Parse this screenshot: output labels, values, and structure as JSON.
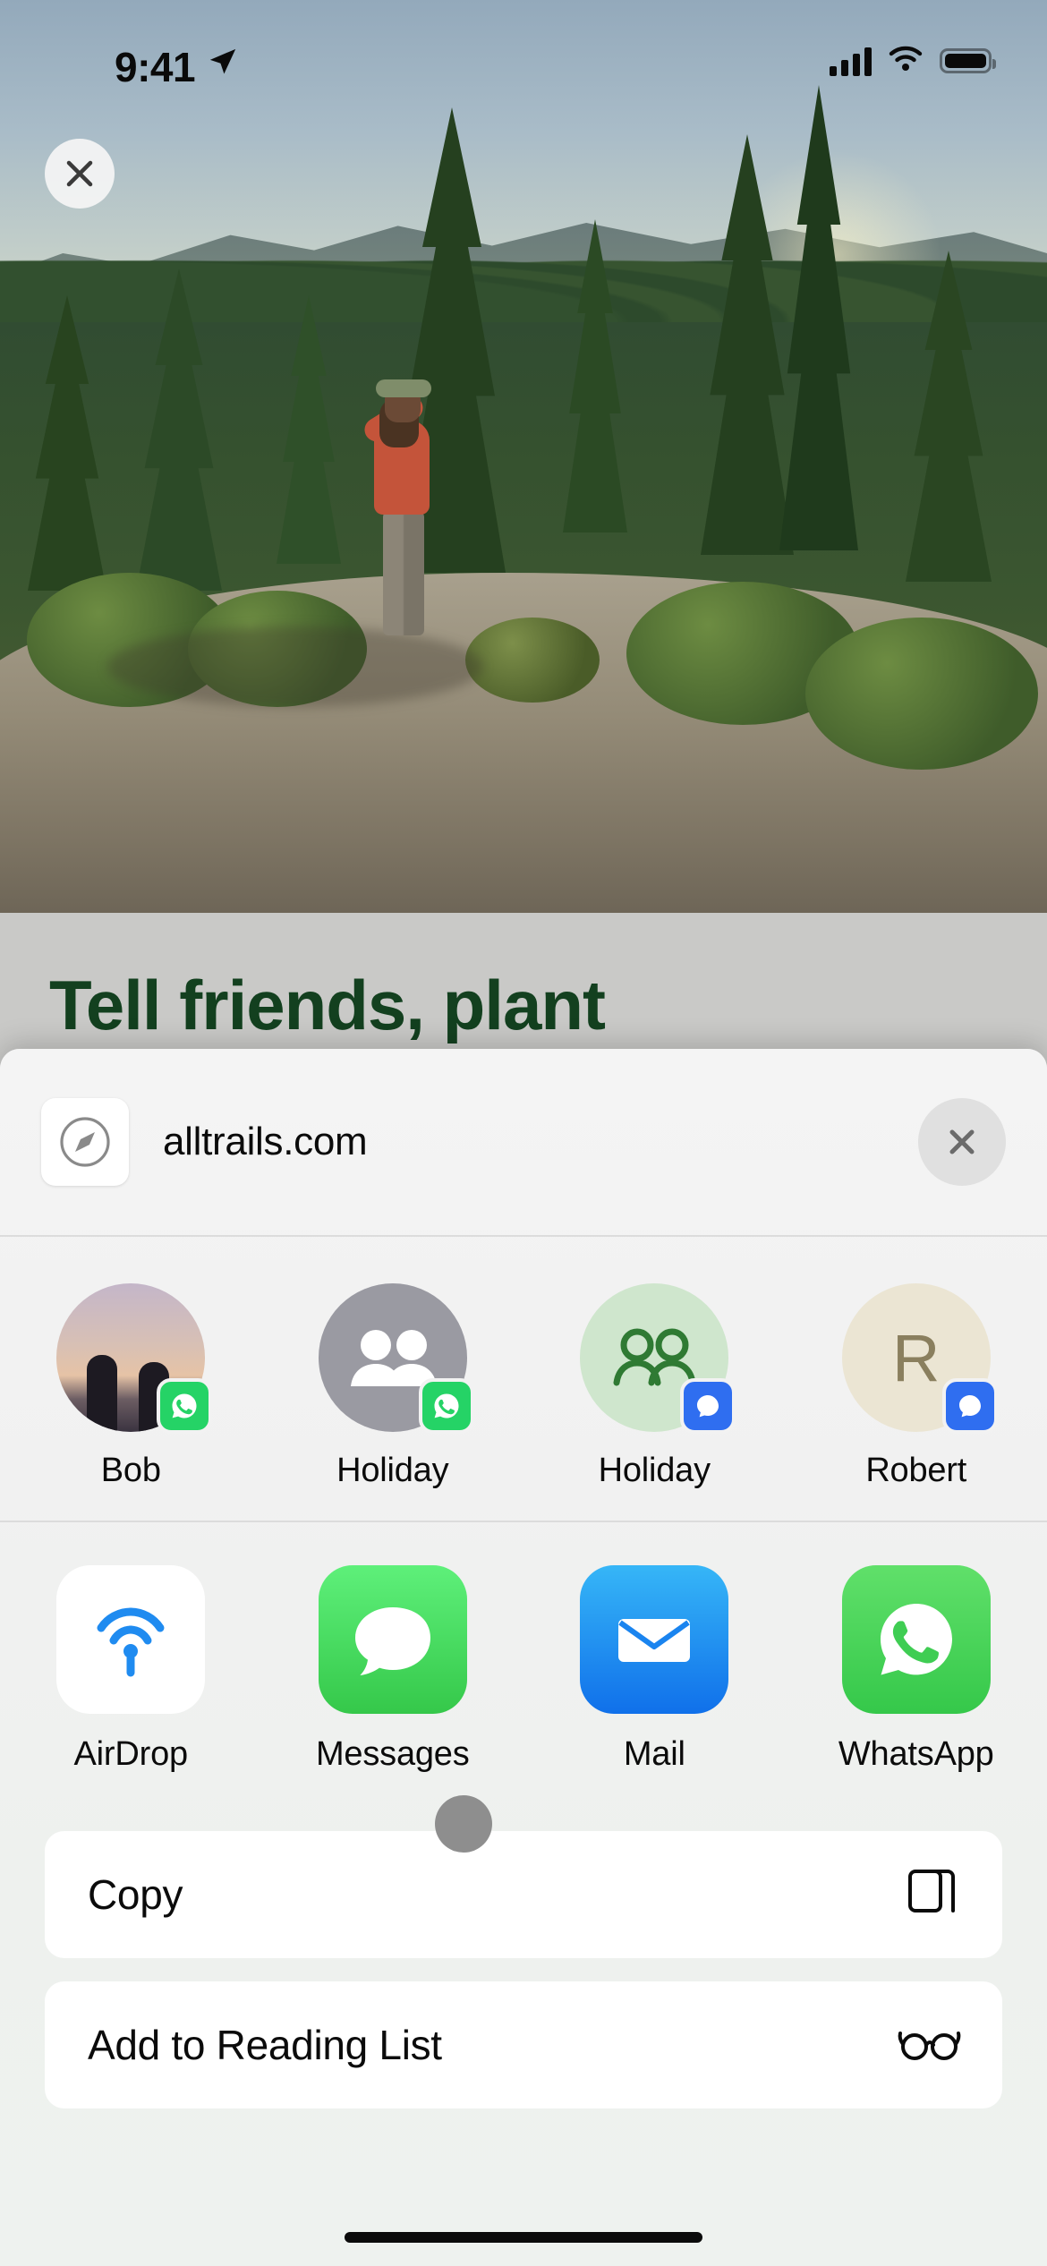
{
  "status_bar": {
    "time": "9:41",
    "location_icon": "location-arrow-icon",
    "cellular_icon": "cellular-bars-icon",
    "wifi_icon": "wifi-icon",
    "battery_icon": "battery-full-icon"
  },
  "background_page": {
    "headline": "Tell friends, plant",
    "close_button_icon": "close-icon",
    "photo_alt": "hiker-on-rock-overlooking-forest"
  },
  "share_sheet": {
    "site": {
      "icon": "safari-compass-icon",
      "title": "alltrails.com"
    },
    "close_button": {
      "icon": "close-icon",
      "label": ""
    },
    "contacts": [
      {
        "name": "Bob",
        "avatar_type": "photo",
        "app_badge": "whatsapp-icon",
        "badge_color": "#25d366"
      },
      {
        "name": "Holiday",
        "avatar_type": "group-gray",
        "app_badge": "whatsapp-icon",
        "badge_color": "#25d366"
      },
      {
        "name": "Holiday",
        "avatar_type": "group-green",
        "app_badge": "signal-icon",
        "badge_color": "#2f6ef0"
      },
      {
        "name": "Robert",
        "avatar_type": "initial",
        "initial": "R",
        "app_badge": "signal-icon",
        "badge_color": "#2f6ef0"
      }
    ],
    "apps": [
      {
        "name": "AirDrop",
        "icon": "airdrop-icon",
        "color": "#ffffff"
      },
      {
        "name": "Messages",
        "icon": "messages-icon",
        "color": "#4cd964"
      },
      {
        "name": "Mail",
        "icon": "mail-icon",
        "color": "#1d8cf0"
      },
      {
        "name": "WhatsApp",
        "icon": "whatsapp-icon",
        "color": "#4bd863"
      },
      {
        "name": "",
        "icon": "partial-app-icon",
        "color": "#f79ab4"
      }
    ],
    "actions": [
      {
        "label": "Copy",
        "icon": "copy-icon"
      },
      {
        "label": "Add to Reading List",
        "icon": "glasses-icon"
      }
    ],
    "scroll_indicator": "scroll-knob"
  },
  "home_indicator": "home-indicator"
}
